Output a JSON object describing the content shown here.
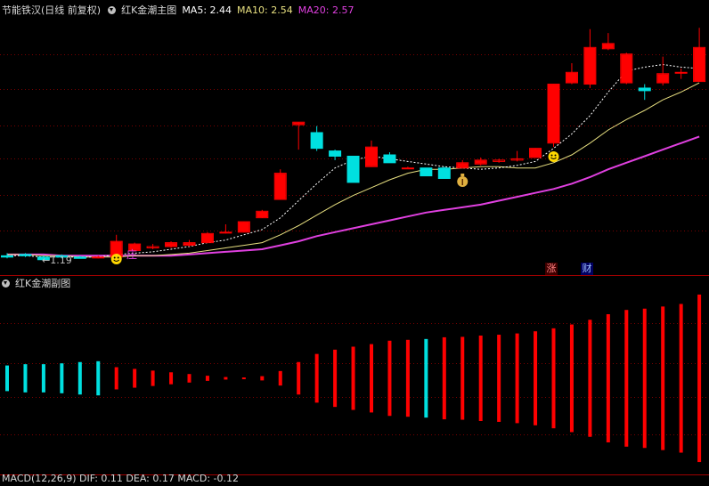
{
  "main_header": {
    "stock_name": "节能铁汉",
    "period": "(日线 前复权)",
    "indicator": "红K金潮主图",
    "ma5_label": "MA5: 2.44",
    "ma10_label": "MA10: 2.54",
    "ma20_label": "MA20: 2.57"
  },
  "sub_header": {
    "indicator": "红K金潮副图"
  },
  "bottom_header": {
    "text": "MACD(12,26,9)  DIF: 0.11  DEA: 0.17  MACD: -0.12"
  },
  "labels": {
    "low_price": "←1.19",
    "zhuang": "庄",
    "zhang": "涨",
    "cai": "财"
  },
  "colors": {
    "bg": "#000000",
    "up": "#ff0000",
    "down": "#00e0e0",
    "ma5": "#ffffff",
    "ma10": "#e8e080",
    "ma20": "#e040e0",
    "grid": "#7a0000"
  },
  "icons": [
    "smiley-icon",
    "money-bag-icon",
    "dropdown-circle-icon"
  ],
  "chart_data": [
    {
      "type": "candlestick",
      "title": "红K金潮主图",
      "candles": [
        {
          "o": 1.22,
          "c": 1.21,
          "h": 1.24,
          "l": 1.2
        },
        {
          "o": 1.23,
          "c": 1.22,
          "h": 1.24,
          "l": 1.21
        },
        {
          "o": 1.21,
          "c": 1.19,
          "h": 1.22,
          "l": 1.19
        },
        {
          "o": 1.22,
          "c": 1.21,
          "h": 1.23,
          "l": 1.2
        },
        {
          "o": 1.21,
          "c": 1.2,
          "h": 1.22,
          "l": 1.2
        },
        {
          "o": 1.21,
          "c": 1.21,
          "h": 1.22,
          "l": 1.2
        },
        {
          "o": 1.21,
          "c": 1.33,
          "h": 1.38,
          "l": 1.21
        },
        {
          "o": 1.26,
          "c": 1.31,
          "h": 1.32,
          "l": 1.26
        },
        {
          "o": 1.28,
          "c": 1.29,
          "h": 1.31,
          "l": 1.27
        },
        {
          "o": 1.29,
          "c": 1.32,
          "h": 1.33,
          "l": 1.28
        },
        {
          "o": 1.3,
          "c": 1.32,
          "h": 1.34,
          "l": 1.29
        },
        {
          "o": 1.32,
          "c": 1.39,
          "h": 1.4,
          "l": 1.32
        },
        {
          "o": 1.4,
          "c": 1.4,
          "h": 1.46,
          "l": 1.39
        },
        {
          "o": 1.4,
          "c": 1.48,
          "h": 1.48,
          "l": 1.4
        },
        {
          "o": 1.51,
          "c": 1.56,
          "h": 1.57,
          "l": 1.51
        },
        {
          "o": 1.65,
          "c": 1.85,
          "h": 1.88,
          "l": 1.65
        },
        {
          "o": 2.22,
          "c": 2.24,
          "h": 2.24,
          "l": 2.03
        },
        {
          "o": 2.16,
          "c": 2.04,
          "h": 2.21,
          "l": 2.02
        },
        {
          "o": 2.02,
          "c": 1.98,
          "h": 2.03,
          "l": 1.95
        },
        {
          "o": 1.98,
          "c": 1.78,
          "h": 1.98,
          "l": 1.78
        },
        {
          "o": 1.9,
          "c": 2.05,
          "h": 2.1,
          "l": 1.9
        },
        {
          "o": 1.99,
          "c": 1.93,
          "h": 2.01,
          "l": 1.93
        },
        {
          "o": 1.89,
          "c": 1.89,
          "h": 1.9,
          "l": 1.89
        },
        {
          "o": 1.89,
          "c": 1.83,
          "h": 1.89,
          "l": 1.83
        },
        {
          "o": 1.89,
          "c": 1.81,
          "h": 1.9,
          "l": 1.81
        },
        {
          "o": 1.89,
          "c": 1.93,
          "h": 1.95,
          "l": 1.89
        },
        {
          "o": 1.92,
          "c": 1.95,
          "h": 1.97,
          "l": 1.91
        },
        {
          "o": 1.94,
          "c": 1.95,
          "h": 1.96,
          "l": 1.93
        },
        {
          "o": 1.95,
          "c": 1.96,
          "h": 2.02,
          "l": 1.94
        },
        {
          "o": 1.97,
          "c": 2.04,
          "h": 2.04,
          "l": 1.97
        },
        {
          "o": 2.08,
          "c": 2.53,
          "h": 2.53,
          "l": 2.05
        },
        {
          "o": 2.54,
          "c": 2.62,
          "h": 2.69,
          "l": 2.53
        },
        {
          "o": 2.53,
          "c": 2.81,
          "h": 2.95,
          "l": 2.5
        },
        {
          "o": 2.8,
          "c": 2.84,
          "h": 2.92,
          "l": 2.79
        },
        {
          "o": 2.54,
          "c": 2.76,
          "h": 2.77,
          "l": 2.53
        },
        {
          "o": 2.5,
          "c": 2.48,
          "h": 2.53,
          "l": 2.41
        },
        {
          "o": 2.54,
          "c": 2.61,
          "h": 2.74,
          "l": 2.52
        },
        {
          "o": 2.62,
          "c": 2.62,
          "h": 2.65,
          "l": 2.57
        },
        {
          "o": 2.55,
          "c": 2.81,
          "h": 2.96,
          "l": 2.55
        }
      ],
      "ma5": [
        1.22,
        1.22,
        1.21,
        1.21,
        1.21,
        1.21,
        1.23,
        1.24,
        1.25,
        1.27,
        1.29,
        1.32,
        1.34,
        1.38,
        1.42,
        1.51,
        1.64,
        1.77,
        1.89,
        1.95,
        1.98,
        1.96,
        1.94,
        1.92,
        1.9,
        1.89,
        1.88,
        1.89,
        1.91,
        1.94,
        2.04,
        2.15,
        2.29,
        2.47,
        2.63,
        2.66,
        2.68,
        2.66,
        2.65
      ],
      "ma10": [
        1.23,
        1.23,
        1.22,
        1.22,
        1.21,
        1.21,
        1.21,
        1.22,
        1.22,
        1.23,
        1.24,
        1.26,
        1.28,
        1.3,
        1.32,
        1.38,
        1.45,
        1.53,
        1.61,
        1.68,
        1.74,
        1.8,
        1.85,
        1.88,
        1.88,
        1.89,
        1.9,
        1.9,
        1.89,
        1.89,
        1.93,
        1.99,
        2.08,
        2.18,
        2.26,
        2.33,
        2.41,
        2.47,
        2.54
      ],
      "ma20": [
        1.23,
        1.23,
        1.23,
        1.22,
        1.22,
        1.22,
        1.22,
        1.22,
        1.22,
        1.22,
        1.23,
        1.24,
        1.25,
        1.26,
        1.27,
        1.3,
        1.33,
        1.37,
        1.4,
        1.43,
        1.46,
        1.49,
        1.52,
        1.55,
        1.57,
        1.59,
        1.61,
        1.64,
        1.67,
        1.7,
        1.73,
        1.77,
        1.82,
        1.88,
        1.93,
        1.98,
        2.03,
        2.08,
        2.13
      ],
      "ylim": [
        1.1,
        3.05
      ],
      "grid": true
    },
    {
      "type": "bar",
      "title": "红K金潮副图",
      "values": [
        -0.3,
        -0.33,
        -0.33,
        -0.35,
        -0.38,
        -0.4,
        -0.26,
        -0.22,
        -0.18,
        -0.14,
        -0.1,
        -0.06,
        -0.03,
        -0.02,
        -0.05,
        -0.17,
        -0.38,
        -0.57,
        -0.67,
        -0.74,
        -0.8,
        -0.88,
        -0.9,
        -0.92,
        -0.96,
        -0.97,
        -1.0,
        -1.02,
        -1.05,
        -1.1,
        -1.17,
        -1.26,
        -1.37,
        -1.5,
        -1.6,
        -1.63,
        -1.68,
        -1.74,
        -1.96
      ],
      "colors": [
        "cyan",
        "cyan",
        "cyan",
        "cyan",
        "cyan",
        "cyan",
        "red",
        "red",
        "red",
        "red",
        "red",
        "red",
        "red",
        "red",
        "red",
        "red",
        "red",
        "red",
        "red",
        "red",
        "red",
        "red",
        "red",
        "cyan",
        "red",
        "red",
        "red",
        "red",
        "red",
        "red",
        "red",
        "red",
        "red",
        "red",
        "red",
        "red",
        "red",
        "red",
        "red"
      ],
      "grid": true
    }
  ]
}
